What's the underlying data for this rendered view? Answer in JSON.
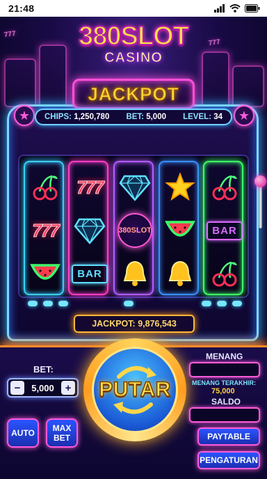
{
  "status_bar": {
    "time": "21:48"
  },
  "logo": {
    "main": "380SLOT",
    "sub": "CASINO"
  },
  "jackpot_sign": "JACKPOT",
  "info_bar": {
    "chips_label": "CHIPS:",
    "chips_value": "1,250,780",
    "bet_label": "BET:",
    "bet_value": "5,000",
    "level_label": "LEVEL:",
    "level_value": "34"
  },
  "reels": [
    {
      "frame_color": "#39d0ff",
      "symbols": [
        "cherry",
        "seven",
        "watermelon"
      ]
    },
    {
      "frame_color": "#ff3cc8",
      "symbols": [
        "seven",
        "diamond",
        "bar"
      ]
    },
    {
      "frame_color": "#b45bff",
      "symbols": [
        "diamond",
        "logo",
        "bell"
      ]
    },
    {
      "frame_color": "#3b8dff",
      "symbols": [
        "star",
        "watermelon",
        "bell"
      ]
    },
    {
      "frame_color": "#3cff6a",
      "symbols": [
        "cherry",
        "bar",
        "cherry"
      ]
    }
  ],
  "symbol_text": {
    "seven": "777",
    "bar": "BAR",
    "logo": "380SLOT"
  },
  "jackpot_display": {
    "label": "JACKPOT:",
    "value": "9,876,543"
  },
  "controls": {
    "bet_label": "BET:",
    "bet_value": "5,000",
    "minus": "−",
    "plus": "+",
    "auto": "AUTO",
    "max_bet_line1": "MAX",
    "max_bet_line2": "BET",
    "spin": "PUTAR",
    "win_label": "MENANG",
    "last_win_label": "MENANG TERAKHIR:",
    "last_win_value": "75,000",
    "balance_label": "SALDO",
    "paytable": "PAYTABLE",
    "settings": "PENGATURAN"
  },
  "colors": {
    "accent_pink": "#ff4fd8",
    "accent_cyan": "#39b8ff",
    "gold": "#ffd93a"
  }
}
